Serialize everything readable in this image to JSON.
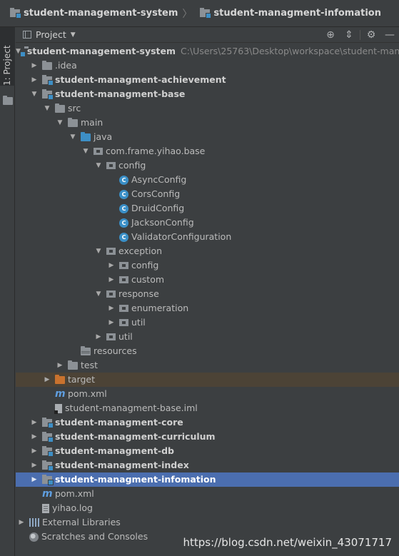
{
  "breadcrumb": {
    "items": [
      {
        "label": "student-management-system",
        "icon": "module-icon"
      },
      {
        "label": "student-managment-infomation",
        "icon": "module-icon"
      }
    ],
    "separator": "〉"
  },
  "toolstrip": {
    "tab_label": "1: Project"
  },
  "panel": {
    "title": "Project",
    "actions": [
      {
        "name": "locate-icon",
        "glyph": "⊕"
      },
      {
        "name": "collapse-all-icon",
        "glyph": "⇕"
      },
      {
        "name": "gear-icon",
        "glyph": "⚙"
      },
      {
        "name": "hide-icon",
        "glyph": "—"
      }
    ]
  },
  "tree": [
    {
      "label": "student-management-system",
      "path": "C:\\Users\\25763\\Desktop\\workspace\\student-manage",
      "icon": "module",
      "depth": 0,
      "arrow": "down",
      "bold": true
    },
    {
      "label": ".idea",
      "icon": "folder",
      "depth": 1,
      "arrow": "right"
    },
    {
      "label": "student-managment-achievement",
      "icon": "module",
      "depth": 1,
      "arrow": "right",
      "bold": true
    },
    {
      "label": "student-managment-base",
      "icon": "module",
      "depth": 1,
      "arrow": "down",
      "bold": true
    },
    {
      "label": "src",
      "icon": "folder",
      "depth": 2,
      "arrow": "down"
    },
    {
      "label": "main",
      "icon": "folder",
      "depth": 3,
      "arrow": "down"
    },
    {
      "label": "java",
      "icon": "folder-blue",
      "depth": 4,
      "arrow": "down"
    },
    {
      "label": "com.frame.yihao.base",
      "icon": "package",
      "depth": 5,
      "arrow": "down"
    },
    {
      "label": "config",
      "icon": "package",
      "depth": 6,
      "arrow": "down"
    },
    {
      "label": "AsyncConfig",
      "icon": "class",
      "depth": 7,
      "arrow": ""
    },
    {
      "label": "CorsConfig",
      "icon": "class",
      "depth": 7,
      "arrow": ""
    },
    {
      "label": "DruidConfig",
      "icon": "class",
      "depth": 7,
      "arrow": ""
    },
    {
      "label": "JacksonConfig",
      "icon": "class",
      "depth": 7,
      "arrow": ""
    },
    {
      "label": "ValidatorConfiguration",
      "icon": "class",
      "depth": 7,
      "arrow": ""
    },
    {
      "label": "exception",
      "icon": "package",
      "depth": 6,
      "arrow": "down"
    },
    {
      "label": "config",
      "icon": "package",
      "depth": 7,
      "arrow": "right"
    },
    {
      "label": "custom",
      "icon": "package",
      "depth": 7,
      "arrow": "right"
    },
    {
      "label": "response",
      "icon": "package",
      "depth": 6,
      "arrow": "down"
    },
    {
      "label": "enumeration",
      "icon": "package",
      "depth": 7,
      "arrow": "right"
    },
    {
      "label": "util",
      "icon": "package",
      "depth": 7,
      "arrow": "right"
    },
    {
      "label": "util",
      "icon": "package",
      "depth": 6,
      "arrow": "right"
    },
    {
      "label": "resources",
      "icon": "folder-res",
      "depth": 4,
      "arrow": ""
    },
    {
      "label": "test",
      "icon": "folder",
      "depth": 3,
      "arrow": "right"
    },
    {
      "label": "target",
      "icon": "folder-orange",
      "depth": 2,
      "arrow": "right",
      "highlight": "excluded"
    },
    {
      "label": "pom.xml",
      "icon": "maven",
      "depth": 2,
      "arrow": ""
    },
    {
      "label": "student-managment-base.iml",
      "icon": "iml",
      "depth": 2,
      "arrow": ""
    },
    {
      "label": "student-managment-core",
      "icon": "module",
      "depth": 1,
      "arrow": "right",
      "bold": true
    },
    {
      "label": "student-managment-curriculum",
      "icon": "module",
      "depth": 1,
      "arrow": "right",
      "bold": true
    },
    {
      "label": "student-managment-db",
      "icon": "module",
      "depth": 1,
      "arrow": "right",
      "bold": true
    },
    {
      "label": "student-managment-index",
      "icon": "module",
      "depth": 1,
      "arrow": "right",
      "bold": true
    },
    {
      "label": "student-managment-infomation",
      "icon": "module",
      "depth": 1,
      "arrow": "right",
      "bold": true,
      "highlight": "selected"
    },
    {
      "label": "pom.xml",
      "icon": "maven",
      "depth": 1,
      "arrow": ""
    },
    {
      "label": "yihao.log",
      "icon": "file",
      "depth": 1,
      "arrow": ""
    },
    {
      "label": "External Libraries",
      "icon": "libraries",
      "depth": 0,
      "arrow": "right"
    },
    {
      "label": "Scratches and Consoles",
      "icon": "scratch",
      "depth": 0,
      "arrow": ""
    }
  ],
  "watermark": "https://blog.csdn.net/weixin_43071717"
}
